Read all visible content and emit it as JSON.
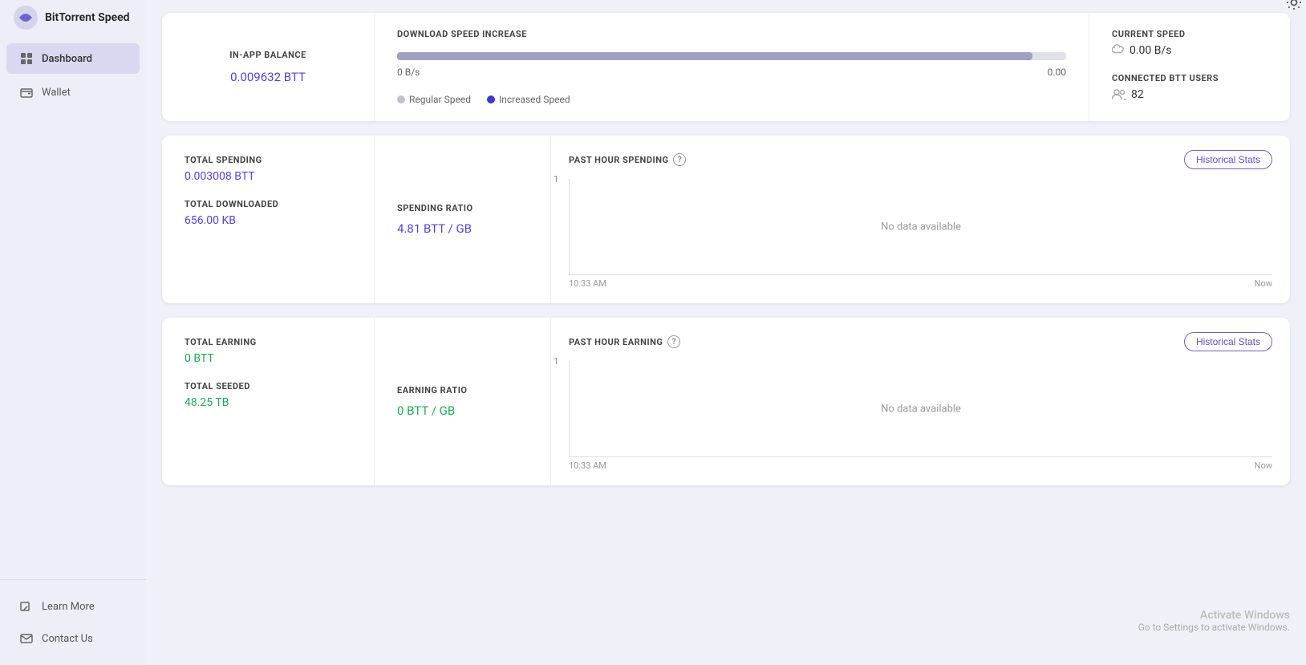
{
  "app": {
    "title": "BitTorrent Speed",
    "logo_alt": "BitTorrent logo"
  },
  "sidebar": {
    "items": [
      {
        "id": "dashboard",
        "label": "Dashboard",
        "active": true,
        "icon": "grid"
      },
      {
        "id": "wallet",
        "label": "Wallet",
        "active": false,
        "icon": "wallet"
      }
    ],
    "bottom_items": [
      {
        "id": "learn-more",
        "label": "Learn More",
        "icon": "info"
      },
      {
        "id": "contact-us",
        "label": "Contact Us",
        "icon": "mail"
      }
    ]
  },
  "row1": {
    "balance": {
      "label": "IN-APP BALANCE",
      "value": "0.009632  BTT"
    },
    "speed": {
      "title": "DOWNLOAD SPEED INCREASE",
      "bar_min": "0 B/s",
      "bar_max": "0.00",
      "legend_regular": "Regular Speed",
      "legend_increased": "Increased Speed"
    },
    "current": {
      "speed_title": "CURRENT SPEED",
      "speed_value": "0.00 B/s",
      "users_title": "CONNECTED BTT USERS",
      "users_value": "82"
    }
  },
  "row2": {
    "totals": {
      "spending_label": "TOTAL SPENDING",
      "spending_value": "0.003008  BTT",
      "downloaded_label": "TOTAL DOWNLOADED",
      "downloaded_value": "656.00  KB"
    },
    "ratio": {
      "label": "SPENDING RATIO",
      "value": "4.81  BTT / GB"
    },
    "chart": {
      "title": "PAST HOUR SPENDING",
      "historical_btn": "Historical Stats",
      "y_label": "1",
      "no_data": "No data available",
      "x_start": "10:33 AM",
      "x_end": "Now"
    }
  },
  "row3": {
    "totals": {
      "earning_label": "TOTAL EARNING",
      "earning_value": "0  BTT",
      "seeded_label": "TOTAL SEEDED",
      "seeded_value": "48.25  TB"
    },
    "ratio": {
      "label": "EARNING RATIO",
      "value": "0  BTT / GB"
    },
    "chart": {
      "title": "PAST HOUR EARNING",
      "historical_btn": "Historical Stats",
      "y_label": "1",
      "no_data": "No data available",
      "x_start": "10:33 AM",
      "x_end": "Now"
    }
  },
  "activate_windows": {
    "line1": "Activate Windows",
    "line2": "Go to Settings to activate Windows."
  }
}
